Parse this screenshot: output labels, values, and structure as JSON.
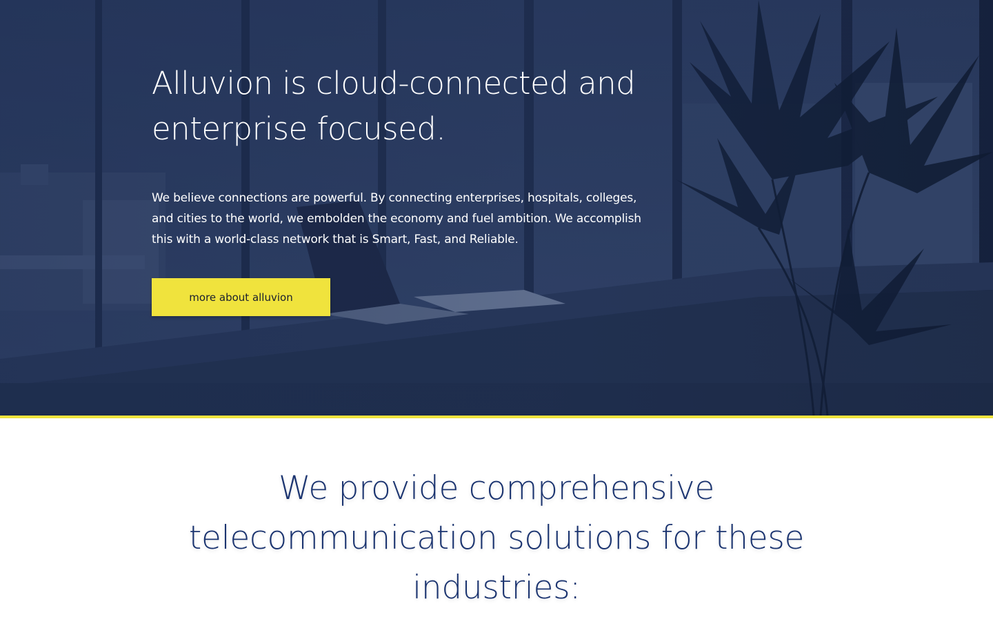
{
  "hero": {
    "title": "Alluvion is cloud-connected and enterprise focused.",
    "text": "We believe connections are powerful. By connecting enterprises, hospitals, colleges, and cities to the world, we embolden the economy and fuel ambition. We accomplish this with a world-class network that is Smart, Fast, and Reliable.",
    "button_label": "more about alluvion",
    "background_image": "office-with-laptop-and-palm-tree"
  },
  "industries": {
    "title": "We provide comprehensive telecommunication solutions for these industries:"
  },
  "colors": {
    "accent": "#f0e33d",
    "navy_heading": "#1b3470",
    "hero_overlay": "#1f2f4e",
    "button_text": "#1a1f2e"
  }
}
